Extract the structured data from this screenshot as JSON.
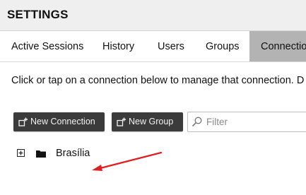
{
  "header": {
    "title": "SETTINGS"
  },
  "tabs": [
    {
      "label": "Active Sessions",
      "active": false
    },
    {
      "label": "History",
      "active": false
    },
    {
      "label": "Users",
      "active": false
    },
    {
      "label": "Groups",
      "active": false
    },
    {
      "label": "Connections",
      "active": true
    }
  ],
  "main": {
    "instructions": "Click or tap on a connection below to manage that connection. D"
  },
  "toolbar": {
    "new_connection_label": "New Connection",
    "new_group_label": "New Group",
    "new_connection_icon": "add-connection-icon",
    "new_group_icon": "add-group-icon"
  },
  "filter": {
    "placeholder": "Filter",
    "value": ""
  },
  "tree": {
    "items": [
      {
        "label": "Brasília",
        "icon": "folder-icon",
        "expander": "expand-plus-icon"
      }
    ]
  },
  "colors": {
    "header_bg": "#efefef",
    "active_tab_bg": "#b3b3b3",
    "button_bg": "#3b3b3b",
    "annotation_arrow": "#e02020"
  }
}
